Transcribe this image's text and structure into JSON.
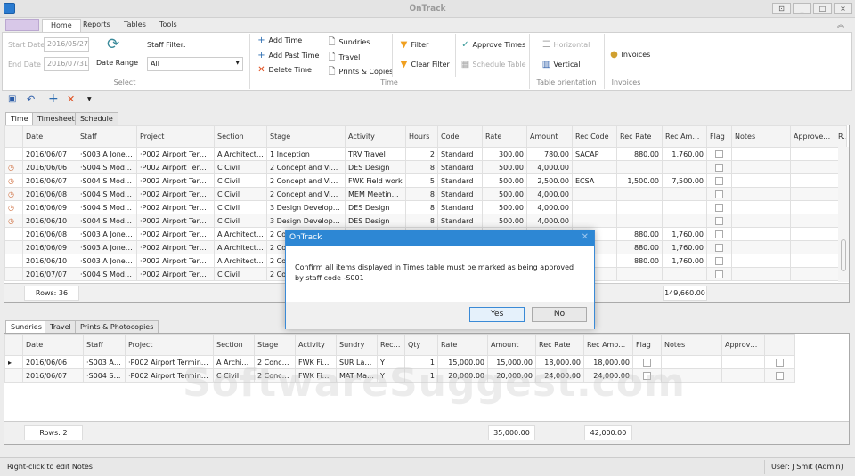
{
  "window": {
    "title": "OnTrack",
    "controls": [
      "⊡",
      "_",
      "□",
      "×"
    ]
  },
  "ribbon_tabs": [
    "Home",
    "Reports",
    "Tables",
    "Tools"
  ],
  "select_group": {
    "start_label": "Start Date",
    "start_value": "2016/05/27",
    "end_label": "End Date",
    "end_value": "2016/07/31",
    "date_range": "Date Range",
    "staff_filter_label": "Staff Filter:",
    "staff_filter_value": "All",
    "label": "Select"
  },
  "time_group": {
    "add_time": "Add Time",
    "add_past_time": "Add Past Time",
    "delete_time": "Delete Time",
    "sundries": "Sundries",
    "travel": "Travel",
    "prints": "Prints & Copies",
    "filter": "Filter",
    "clear_filter": "Clear Filter",
    "approve": "Approve Times",
    "schedule": "Schedule Table",
    "label": "Time"
  },
  "orientation_group": {
    "horizontal": "Horizontal",
    "vertical": "Vertical",
    "label": "Table orientation"
  },
  "invoices_group": {
    "invoices": "Invoices",
    "label": "Invoices"
  },
  "main_tabs": [
    "Time",
    "Timesheet",
    "Schedule"
  ],
  "time_grid": {
    "columns": [
      "Date",
      "Staff",
      "Project",
      "Section",
      "Stage",
      "Activity",
      "Hours",
      "Code",
      "Rate",
      "Amount",
      "Rec Code",
      "Rec Rate",
      "Rec Amount",
      "Flag",
      "Notes",
      "Approved By",
      "Re"
    ],
    "rows": [
      {
        "icon": false,
        "cells": [
          "2016/06/07",
          "·S003 A Jones ...",
          "·P002 Airport Termin...",
          "A Architectural",
          "1 Inception",
          "TRV Travel",
          "2",
          "Standard",
          "300.00",
          "780.00",
          "SACAP",
          "880.00",
          "1,760.00"
        ]
      },
      {
        "icon": true,
        "cells": [
          "2016/06/06",
          "·S004 S Modis...",
          "·P002 Airport Termin...",
          "C Civil",
          "2 Concept and Viability",
          "DES Design",
          "8",
          "Standard",
          "500.00",
          "4,000.00",
          "",
          "",
          ""
        ]
      },
      {
        "icon": true,
        "cells": [
          "2016/06/07",
          "·S004 S Modis...",
          "·P002 Airport Termin...",
          "C Civil",
          "2 Concept and Viability",
          "FWK Field work",
          "5",
          "Standard",
          "500.00",
          "2,500.00",
          "ECSA",
          "1,500.00",
          "7,500.00"
        ]
      },
      {
        "icon": true,
        "cells": [
          "2016/06/08",
          "·S004 S Modis...",
          "·P002 Airport Termin...",
          "C Civil",
          "2 Concept and Viability",
          "MEM Meetings/...",
          "8",
          "Standard",
          "500.00",
          "4,000.00",
          "",
          "",
          ""
        ]
      },
      {
        "icon": true,
        "cells": [
          "2016/06/09",
          "·S004 S Modis...",
          "·P002 Airport Termin...",
          "C Civil",
          "3 Design Development",
          "DES Design",
          "8",
          "Standard",
          "500.00",
          "4,000.00",
          "",
          "",
          ""
        ]
      },
      {
        "icon": true,
        "cells": [
          "2016/06/10",
          "·S004 S Modis...",
          "·P002 Airport Termin...",
          "C Civil",
          "3 Design Development",
          "DES Design",
          "8",
          "Standard",
          "500.00",
          "4,000.00",
          "",
          "",
          ""
        ]
      },
      {
        "icon": false,
        "cells": [
          "2016/06/08",
          "·S003 A Jones ...",
          "·P002 Airport Termin...",
          "A Architectural",
          "2 Co",
          "",
          "",
          "",
          "",
          "",
          "",
          "880.00",
          "1,760.00"
        ]
      },
      {
        "icon": false,
        "cells": [
          "2016/06/09",
          "·S003 A Jones ...",
          "·P002 Airport Termin...",
          "A Architectural",
          "2 Co",
          "",
          "",
          "",
          "",
          "",
          "",
          "880.00",
          "1,760.00"
        ]
      },
      {
        "icon": false,
        "cells": [
          "2016/06/10",
          "·S003 A Jones ...",
          "·P002 Airport Termin...",
          "A Architectural",
          "2 Co",
          "",
          "",
          "",
          "",
          "",
          "",
          "880.00",
          "1,760.00"
        ]
      },
      {
        "icon": false,
        "cells": [
          "2016/07/07",
          "·S004 S Modis...",
          "·P002 Airport Termin...",
          "C Civil",
          "2 Co",
          "",
          "",
          "",
          "",
          "",
          "",
          "",
          ""
        ]
      }
    ],
    "rows_count": "Rows: 36",
    "total_rec_amount": "149,660.00"
  },
  "lower_tabs": [
    "Sundries",
    "Travel",
    "Prints & Photocopies"
  ],
  "sundries_grid": {
    "columns": [
      "Date",
      "Staff",
      "Project",
      "Section",
      "Stage",
      "Activity",
      "Sundry",
      "Rec YN",
      "Qty",
      "Rate",
      "Amount",
      "Rec Rate",
      "Rec Amount",
      "Flag",
      "Notes",
      "Approved By",
      ""
    ],
    "rows": [
      [
        "2016/06/06",
        "·S003 A ...",
        "·P002 Airport Terminal B...",
        "A Archite...",
        "2 Conce...",
        "FWK Fiel...",
        "SUR Lan...",
        "Y",
        "1",
        "15,000.00",
        "15,000.00",
        "18,000.00",
        "18,000.00"
      ],
      [
        "2016/06/07",
        "·S004 S ...",
        "·P002 Airport Terminal B...",
        "C Civil",
        "2 Conce...",
        "FWK Fiel...",
        "MAT Mat...",
        "Y",
        "1",
        "20,000.00",
        "20,000.00",
        "24,000.00",
        "24,000.00"
      ]
    ],
    "rows_count": "Rows: 2",
    "total_amount": "35,000.00",
    "total_rec_amount": "42,000.00"
  },
  "dialog": {
    "title": "OnTrack",
    "message": "Confirm all items displayed in Times table must be marked as being approved by staff code -S001",
    "yes": "Yes",
    "no": "No"
  },
  "status": {
    "left": "Right-click to edit Notes",
    "user": "User: J Smit (Admin)"
  },
  "watermark": "SoftwareSuggest.com",
  "colors": {
    "accent": "#2d87d4"
  }
}
